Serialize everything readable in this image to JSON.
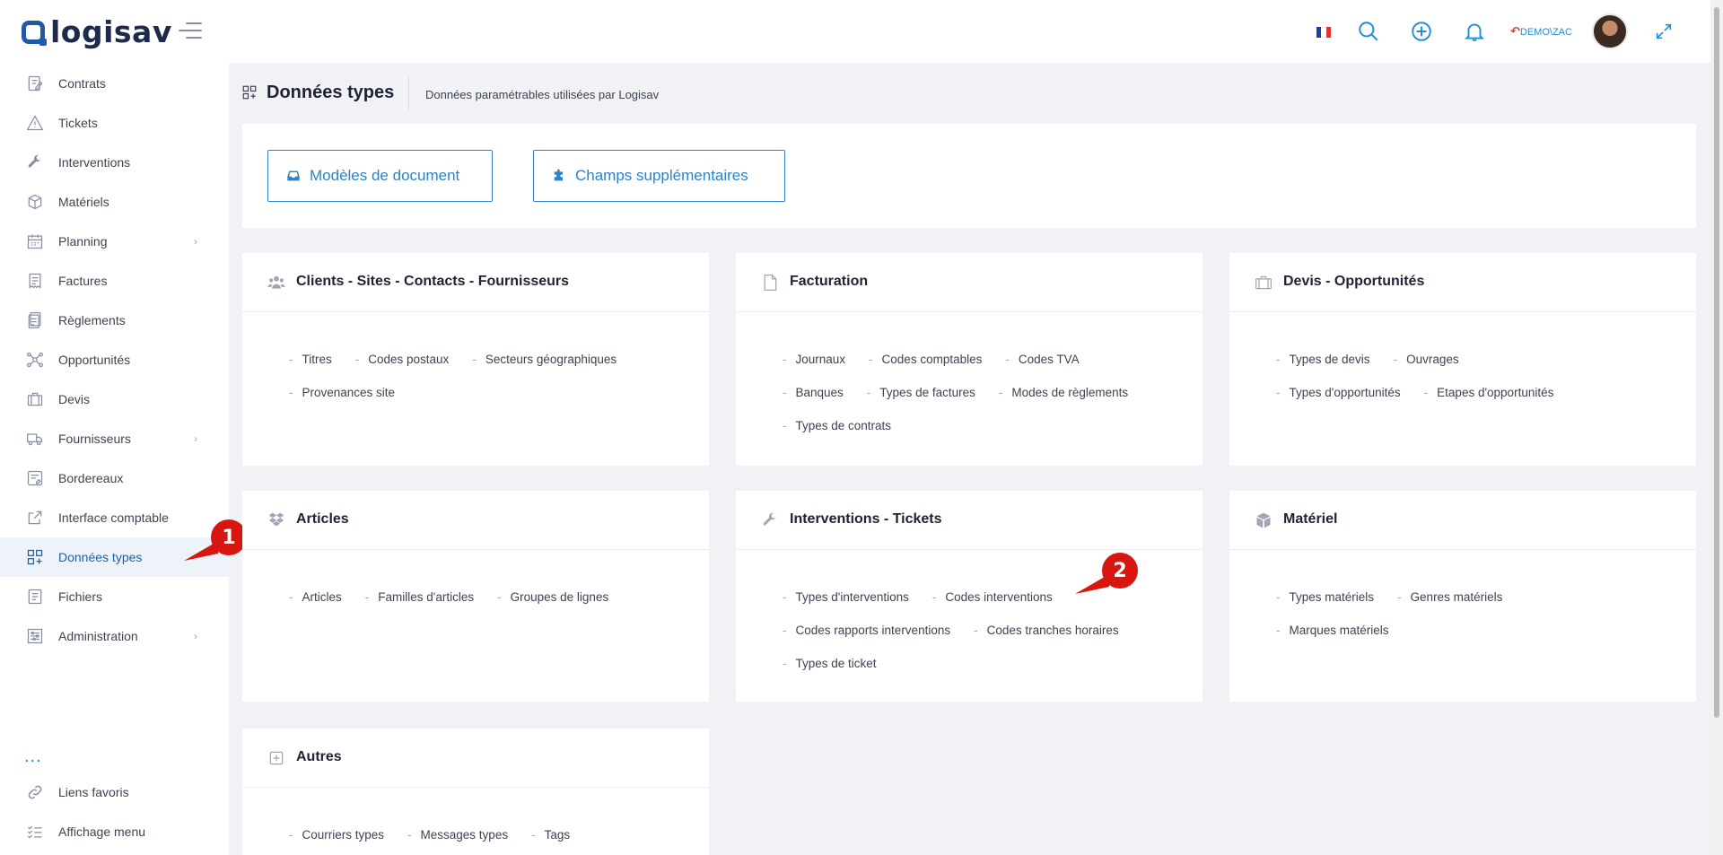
{
  "app": {
    "logo": "logisav"
  },
  "header": {
    "user": "DEMO\\ZAC",
    "flag_colors": [
      "#1f3c9a",
      "#ffffff",
      "#e0342f"
    ]
  },
  "sidebar": {
    "items": [
      {
        "label": "Contrats",
        "icon": "contract-icon"
      },
      {
        "label": "Tickets",
        "icon": "warning-icon"
      },
      {
        "label": "Interventions",
        "icon": "wrench-icon"
      },
      {
        "label": "Matériels",
        "icon": "box-icon"
      },
      {
        "label": "Planning",
        "icon": "calendar-icon",
        "chevron": true
      },
      {
        "label": "Factures",
        "icon": "invoice-icon"
      },
      {
        "label": "Règlements",
        "icon": "payment-icon"
      },
      {
        "label": "Opportunités",
        "icon": "network-icon"
      },
      {
        "label": "Devis",
        "icon": "briefcase-icon"
      },
      {
        "label": "Fournisseurs",
        "icon": "truck-icon",
        "chevron": true
      },
      {
        "label": "Bordereaux",
        "icon": "slip-icon"
      },
      {
        "label": "Interface comptable",
        "icon": "external-link-icon"
      },
      {
        "label": "Données types",
        "icon": "grid-plus-icon",
        "active": true
      },
      {
        "label": "Fichiers",
        "icon": "file-icon"
      },
      {
        "label": "Administration",
        "icon": "settings-list-icon",
        "chevron": true
      }
    ],
    "dots": "...",
    "bottom": [
      {
        "label": "Liens favoris",
        "icon": "link-icon"
      },
      {
        "label": "Affichage menu",
        "icon": "menu-list-icon"
      }
    ]
  },
  "subheader": {
    "title": "Données types",
    "description": "Données paramétrables utilisées par Logisav"
  },
  "actions": {
    "documents": "Modèles de document",
    "fields": "Champs supplémentaires"
  },
  "annotations": {
    "badge1": "1",
    "badge2": "2"
  },
  "cards": [
    {
      "title": "Clients - Sites - Contacts - Fournisseurs",
      "icon": "users-icon",
      "links": [
        "Titres",
        "Codes postaux",
        "Secteurs géographiques",
        "Provenances site"
      ]
    },
    {
      "title": "Facturation",
      "icon": "document-icon",
      "links": [
        "Journaux",
        "Codes comptables",
        "Codes TVA",
        "Banques",
        "Types de factures",
        "Modes de règlements",
        "Types de contrats"
      ]
    },
    {
      "title": "Devis - Opportunités",
      "icon": "briefcase-icon",
      "links": [
        "Types de devis",
        "Ouvrages",
        "Types d'opportunités",
        "Etapes d'opportunités"
      ]
    },
    {
      "title": "Articles",
      "icon": "dropbox-icon",
      "links": [
        "Articles",
        "Familles d'articles",
        "Groupes de lignes"
      ]
    },
    {
      "title": "Interventions - Tickets",
      "icon": "wrench-icon",
      "links": [
        "Types d'interventions",
        "Codes interventions",
        "Codes rapports interventions",
        "Codes tranches horaires",
        "Types de ticket"
      ]
    },
    {
      "title": "Matériel",
      "icon": "cube-icon",
      "links": [
        "Types matériels",
        "Genres matériels",
        "Marques matériels"
      ]
    },
    {
      "title": "Autres",
      "icon": "plus-square-icon",
      "links": [
        "Courriers types",
        "Messages types",
        "Tags"
      ]
    }
  ]
}
